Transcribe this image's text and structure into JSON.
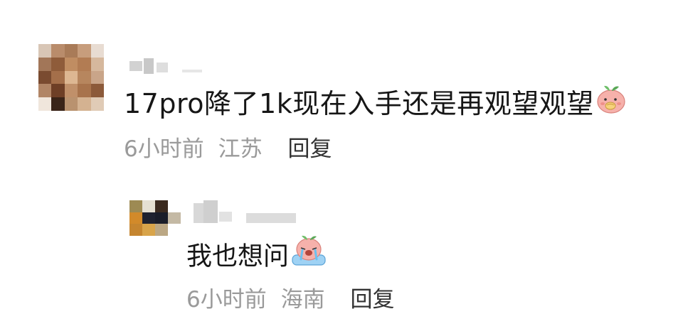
{
  "comments": [
    {
      "text": "17pro降了1k现在入手还是再观望观望",
      "emoji": "peach-thinking-emoji",
      "time": "6小时前",
      "location": "江苏",
      "reply_label": "回复",
      "replies": [
        {
          "text": "我也想问",
          "emoji": "peach-crying-emoji",
          "time": "6小时前",
          "location": "海南",
          "reply_label": "回复"
        }
      ]
    }
  ],
  "colors": {
    "text": "#161616",
    "meta": "#9a9a9a",
    "reply": "#333333",
    "emoji_face": "#f4a7a3"
  }
}
